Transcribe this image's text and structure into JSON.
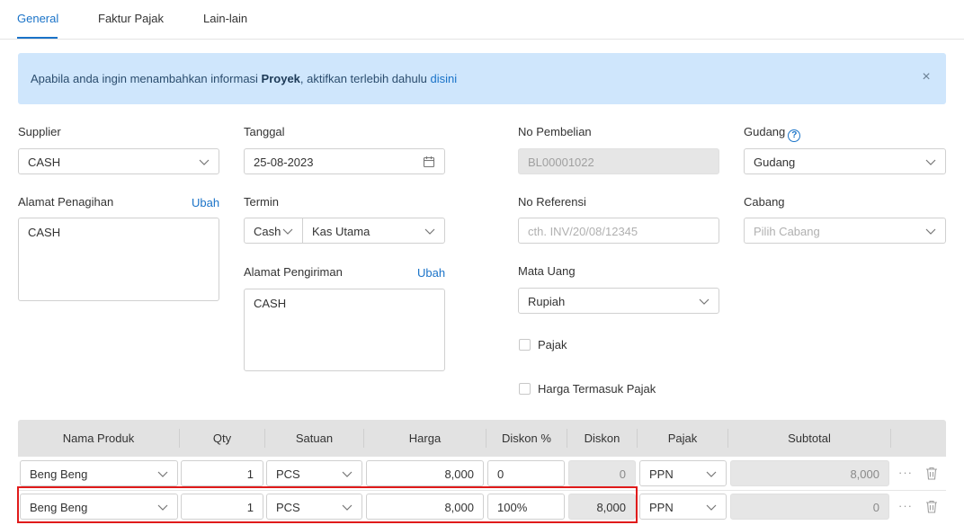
{
  "tabs": [
    {
      "label": "General",
      "active": true
    },
    {
      "label": "Faktur Pajak",
      "active": false
    },
    {
      "label": "Lain-lain",
      "active": false
    }
  ],
  "alert": {
    "prefix": "Apabila anda ingin menambahkan informasi ",
    "bold": "Proyek",
    "middle": ", aktifkan terlebih dahulu ",
    "link": "disini",
    "close": "×"
  },
  "form": {
    "supplier": {
      "label": "Supplier",
      "value": "CASH"
    },
    "alamat_penagihan": {
      "label": "Alamat Penagihan",
      "action": "Ubah",
      "value": "CASH"
    },
    "tanggal": {
      "label": "Tanggal",
      "value": "25-08-2023"
    },
    "termin": {
      "label": "Termin",
      "type_value": "Cash",
      "account_value": "Kas Utama"
    },
    "alamat_pengiriman": {
      "label": "Alamat Pengiriman",
      "action": "Ubah",
      "value": "CASH"
    },
    "no_pembelian": {
      "label": "No Pembelian",
      "value": "BL00001022"
    },
    "no_referensi": {
      "label": "No Referensi",
      "placeholder": "cth. INV/20/08/12345"
    },
    "mata_uang": {
      "label": "Mata Uang",
      "value": "Rupiah"
    },
    "pajak": {
      "label": "Pajak",
      "checked": false
    },
    "harga_termasuk_pajak": {
      "label": "Harga Termasuk Pajak",
      "checked": false
    },
    "gudang": {
      "label": "Gudang",
      "value": "Gudang",
      "help": "?"
    },
    "cabang": {
      "label": "Cabang",
      "placeholder": "Pilih Cabang"
    }
  },
  "table": {
    "headers": [
      "Nama Produk",
      "Qty",
      "Satuan",
      "Harga",
      "Diskon %",
      "Diskon",
      "Pajak",
      "Subtotal"
    ],
    "rows": [
      {
        "produk": "Beng Beng",
        "qty": "1",
        "satuan": "PCS",
        "harga": "8,000",
        "diskon_pct": "0",
        "diskon": "0",
        "pajak": "PPN",
        "subtotal": "8,000",
        "actions": "···"
      },
      {
        "produk": "Beng Beng",
        "qty": "1",
        "satuan": "PCS",
        "harga": "8,000",
        "diskon_pct": "100%",
        "diskon": "8,000",
        "pajak": "PPN",
        "subtotal": "0",
        "actions": "···"
      }
    ]
  },
  "colors": {
    "accent": "#1a73c8",
    "alert_bg": "#cfe6fc",
    "highlight": "#e01b1b",
    "header_bg": "#e2e2e2"
  }
}
